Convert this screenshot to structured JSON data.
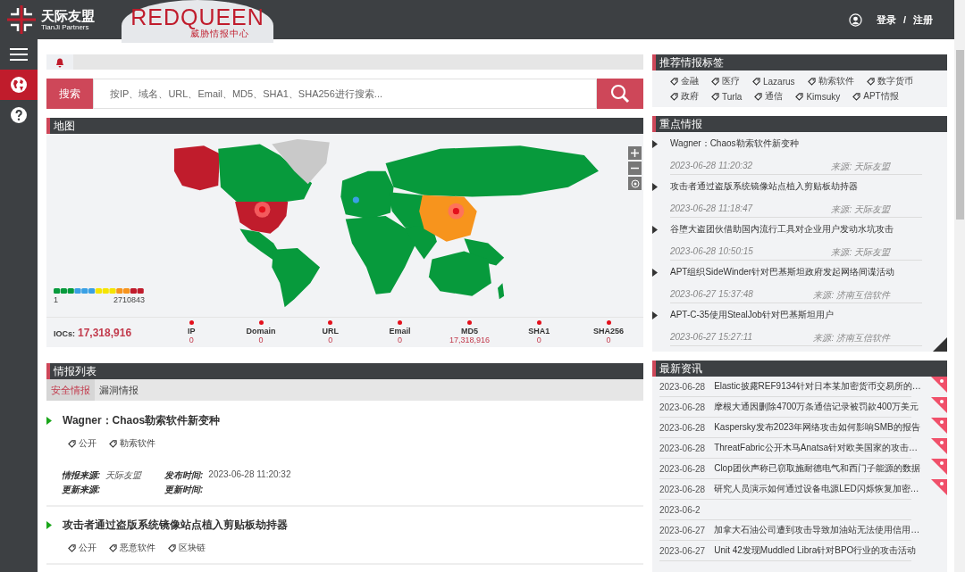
{
  "header": {
    "logo_name": "天际友盟",
    "logo_subtitle": "TianJi Partners",
    "brand": "REDQUEEN",
    "brand_subtitle": "威胁情报中心",
    "login": "登录",
    "separator": "/",
    "register": "注册"
  },
  "sidebar": {
    "items": [
      {
        "kind": "menu",
        "selected": false
      },
      {
        "kind": "globe",
        "selected": true
      },
      {
        "kind": "help",
        "selected": false
      }
    ]
  },
  "search": {
    "button": "搜索",
    "placeholder": "按IP、域名、URL、Email、MD5、SHA1、SHA256进行搜索..."
  },
  "map_panel": {
    "title": "地图",
    "legend_min": "1",
    "legend_max": "2710843",
    "iocs_label": "IOCs:",
    "iocs_value": "17,318,916",
    "stats": [
      {
        "name": "IP",
        "value": "0"
      },
      {
        "name": "Domain",
        "value": "0"
      },
      {
        "name": "URL",
        "value": "0"
      },
      {
        "name": "Email",
        "value": "0"
      },
      {
        "name": "MD5",
        "value": "17,318,916"
      },
      {
        "name": "SHA1",
        "value": "0"
      },
      {
        "name": "SHA256",
        "value": "0"
      }
    ]
  },
  "intel_list": {
    "title": "情报列表",
    "tabs": [
      {
        "label": "安全情报",
        "selected": true
      },
      {
        "label": "漏洞情报",
        "selected": false
      }
    ],
    "items": [
      {
        "title": "Wagner：Chaos勒索软件新变种",
        "tags": [
          "公开",
          "勒索软件"
        ],
        "source_label": "情报来源:",
        "source": "天际友盟",
        "publish_label": "发布时间:",
        "publish_time": "2023-06-28 11:20:32",
        "update_source_label": "更新来源:",
        "update_time_label": "更新时间:"
      },
      {
        "title": "攻击者通过盗版系统镜像站点植入剪贴板劫持器",
        "tags": [
          "公开",
          "恶意软件",
          "区块链"
        ]
      }
    ]
  },
  "tags_panel": {
    "title": "推荐情报标签",
    "tags": [
      "金融",
      "医疗",
      "Lazarus",
      "勒索软件",
      "数字货币",
      "政府",
      "Turla",
      "通信",
      "Kimsuky",
      "APT情报"
    ]
  },
  "key_intel": {
    "title": "重点情报",
    "items": [
      {
        "title": "Wagner：Chaos勒索软件新变种",
        "time": "2023-06-28 11:20:32",
        "source": "来源: 天际友盟"
      },
      {
        "title": "攻击者通过盗版系统镜像站点植入剪贴板劫持器",
        "time": "2023-06-28 11:18:47",
        "source": "来源: 天际友盟"
      },
      {
        "title": "谷堕大盗团伙借助国内流行工具对企业用户发动水坑攻击",
        "time": "2023-06-28 10:50:15",
        "source": "来源: 天际友盟"
      },
      {
        "title": "APT组织SideWinder针对巴基斯坦政府发起网络间谍活动",
        "time": "2023-06-27 15:37:48",
        "source": "来源: 济南互信软件"
      },
      {
        "title": "APT-C-35使用StealJob针对巴基斯坦用户",
        "time": "2023-06-27 15:27:11",
        "source": "来源: 济南互信软件"
      }
    ]
  },
  "news": {
    "title": "最新资讯",
    "items": [
      {
        "date": "2023-06-28",
        "title": "Elastic披露REF9134针对日本某加密货币交易所的…",
        "flagged": true
      },
      {
        "date": "2023-06-28",
        "title": "摩根大通因删除4700万条通信记录被罚款400万美元",
        "flagged": true
      },
      {
        "date": "2023-06-28",
        "title": "Kaspersky发布2023年网络攻击如何影响SMB的报告",
        "flagged": true
      },
      {
        "date": "2023-06-28",
        "title": "ThreatFabric公开木马Anatsa针对欧美国家的攻击…",
        "flagged": true
      },
      {
        "date": "2023-06-28",
        "title": "Clop团伙声称已窃取施耐德电气和西门子能源的数据",
        "flagged": true
      },
      {
        "date": "2023-06-28",
        "title": "研究人员演示如何通过设备电源LED闪烁恢复加密…",
        "flagged": true
      },
      {
        "date": "2023-06-2",
        "flagged": false
      },
      {
        "date": "2023-06-27",
        "title": "加拿大石油公司遭到攻击导致加油站无法使用信用…",
        "flagged": false
      },
      {
        "date": "2023-06-27",
        "title": "Unit 42发现Muddled Libra针对BPO行业的攻击活动",
        "flagged": false
      }
    ]
  }
}
